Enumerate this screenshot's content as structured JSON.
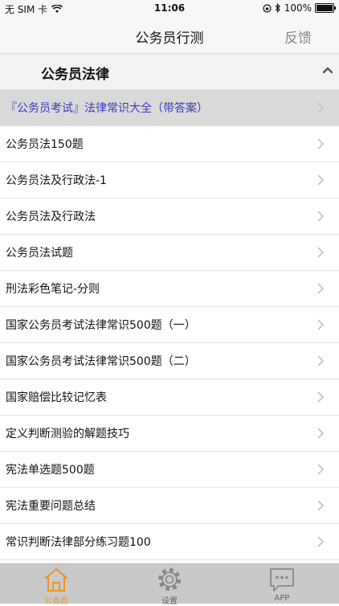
{
  "status_bar": {
    "carrier": "无 SIM 卡",
    "time": "11:06",
    "battery": "100%"
  },
  "nav_bar": {
    "title": "公务员行测",
    "feedback": "反馈"
  },
  "section": {
    "title": "公务员法律"
  },
  "list": {
    "items": [
      {
        "label": "『公务员考试』法律常识大全（带答案）"
      },
      {
        "label": "公务员法150题"
      },
      {
        "label": "公务员法及行政法-1"
      },
      {
        "label": "公务员法及行政法"
      },
      {
        "label": "公务员法试题"
      },
      {
        "label": "刑法彩色笔记-分则"
      },
      {
        "label": "国家公务员考试法律常识500题（一）"
      },
      {
        "label": "国家公务员考试法律常识500题（二）"
      },
      {
        "label": "国家赔偿比较记忆表"
      },
      {
        "label": "定义判断测验的解题技巧"
      },
      {
        "label": "宪法单选题500题"
      },
      {
        "label": "宪法重要问题总结"
      },
      {
        "label": "常识判断法律部分练习题100"
      }
    ]
  },
  "tab_bar": {
    "tabs": [
      {
        "label": "公务员",
        "icon": "home-icon"
      },
      {
        "label": "设置",
        "icon": "gear-icon"
      },
      {
        "label": "APP",
        "icon": "chat-icon"
      }
    ],
    "active_color": "#e8951d"
  }
}
